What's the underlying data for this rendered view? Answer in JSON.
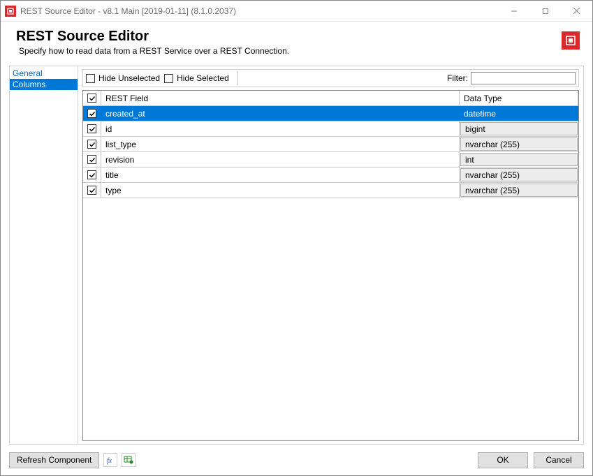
{
  "window_title": "REST Source Editor - v8.1 Main [2019-01-11] (8.1.0.2037)",
  "header": {
    "title": "REST Source Editor",
    "subtitle": "Specify how to read data from a REST Service over a REST Connection."
  },
  "sidebar": {
    "items": [
      {
        "label": "General",
        "selected": false
      },
      {
        "label": "Columns",
        "selected": true
      }
    ]
  },
  "toolbar": {
    "hide_unselected": "Hide Unselected",
    "hide_selected": "Hide Selected",
    "filter_label": "Filter:",
    "filter_value": ""
  },
  "grid": {
    "headers": {
      "field": "REST Field",
      "type": "Data Type"
    },
    "rows": [
      {
        "checked": true,
        "field": "created_at",
        "type": "datetime",
        "selected": true
      },
      {
        "checked": true,
        "field": "id",
        "type": "bigint",
        "selected": false
      },
      {
        "checked": true,
        "field": "list_type",
        "type": "nvarchar (255)",
        "selected": false
      },
      {
        "checked": true,
        "field": "revision",
        "type": "int",
        "selected": false
      },
      {
        "checked": true,
        "field": "title",
        "type": "nvarchar (255)",
        "selected": false
      },
      {
        "checked": true,
        "field": "type",
        "type": "nvarchar (255)",
        "selected": false
      }
    ]
  },
  "footer": {
    "refresh": "Refresh Component",
    "ok": "OK",
    "cancel": "Cancel"
  },
  "icons": {
    "app": "app-icon",
    "fx": "fx-icon",
    "table": "table-icon"
  }
}
